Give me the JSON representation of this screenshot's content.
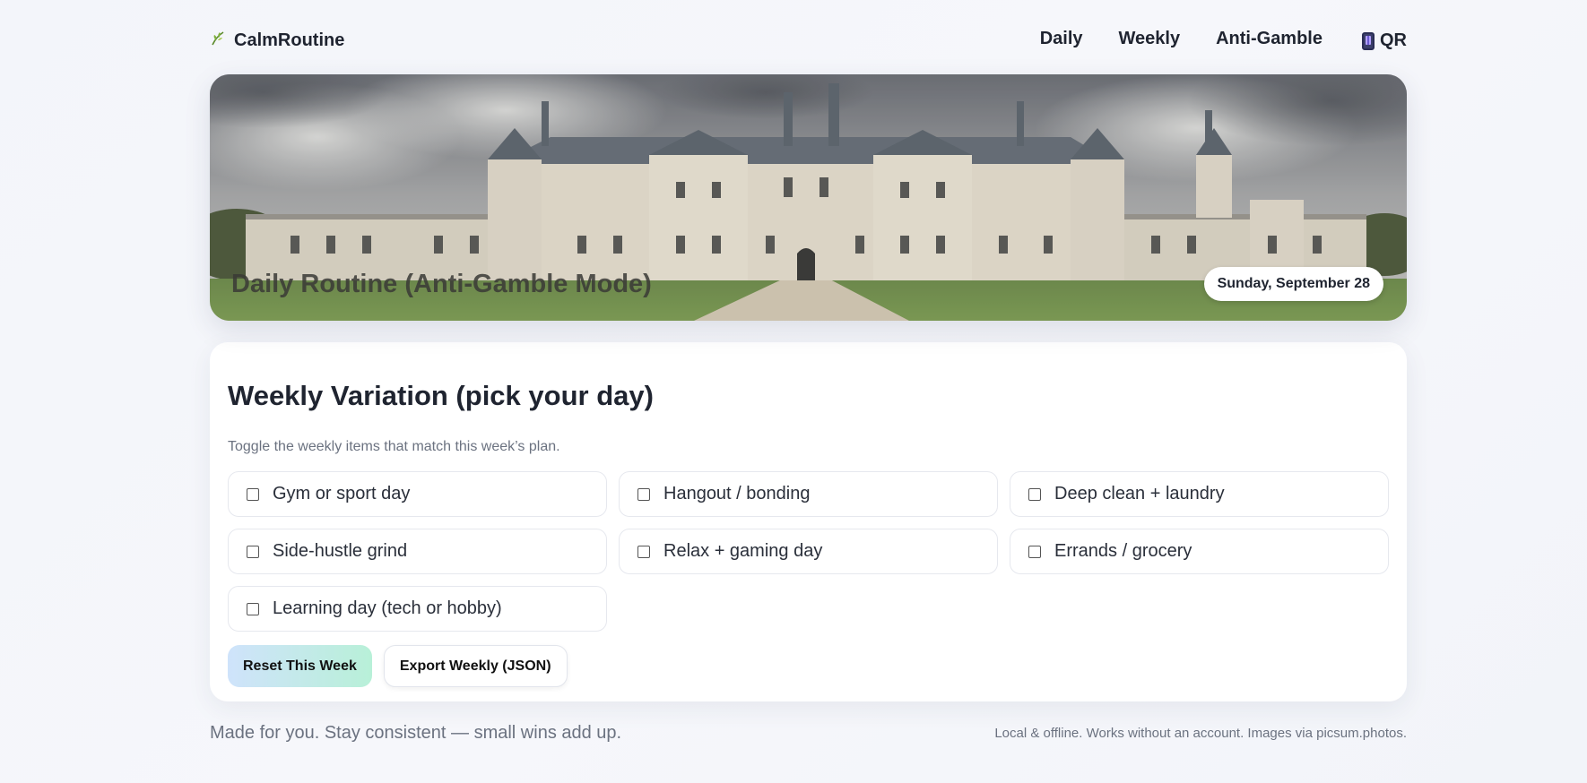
{
  "nav": {
    "brand_icon": "leaf-icon",
    "brand": "CalmRoutine",
    "links": [
      "Daily",
      "Weekly",
      "Anti-Gamble"
    ],
    "qr_icon": "phone-icon",
    "qr_label": "QR"
  },
  "hero": {
    "title": "Daily Routine (Anti-Gamble Mode)",
    "date": "Sunday, September 28"
  },
  "weekly": {
    "title": "Weekly Variation (pick your day)",
    "subtitle": "Toggle the weekly items that match this week’s plan.",
    "items": [
      {
        "label": "Gym or sport day",
        "checked": false
      },
      {
        "label": "Hangout / bonding",
        "checked": false
      },
      {
        "label": "Deep clean + laundry",
        "checked": false
      },
      {
        "label": "Side-hustle grind",
        "checked": false
      },
      {
        "label": "Relax + gaming day",
        "checked": false
      },
      {
        "label": "Errands / grocery",
        "checked": false
      },
      {
        "label": "Learning day (tech or hobby)",
        "checked": false
      }
    ],
    "reset_label": "Reset This Week",
    "export_label": "Export Weekly (JSON)"
  },
  "footer": {
    "left": "Made for you. Stay consistent — small wins add up.",
    "right": "Local & offline. Works without an account. Images via picsum.photos."
  },
  "colors": {
    "primary_gradient_start": "#cfe3fb",
    "primary_gradient_end": "#b8f0d8",
    "text": "#1f2430",
    "muted": "#6b7280"
  }
}
